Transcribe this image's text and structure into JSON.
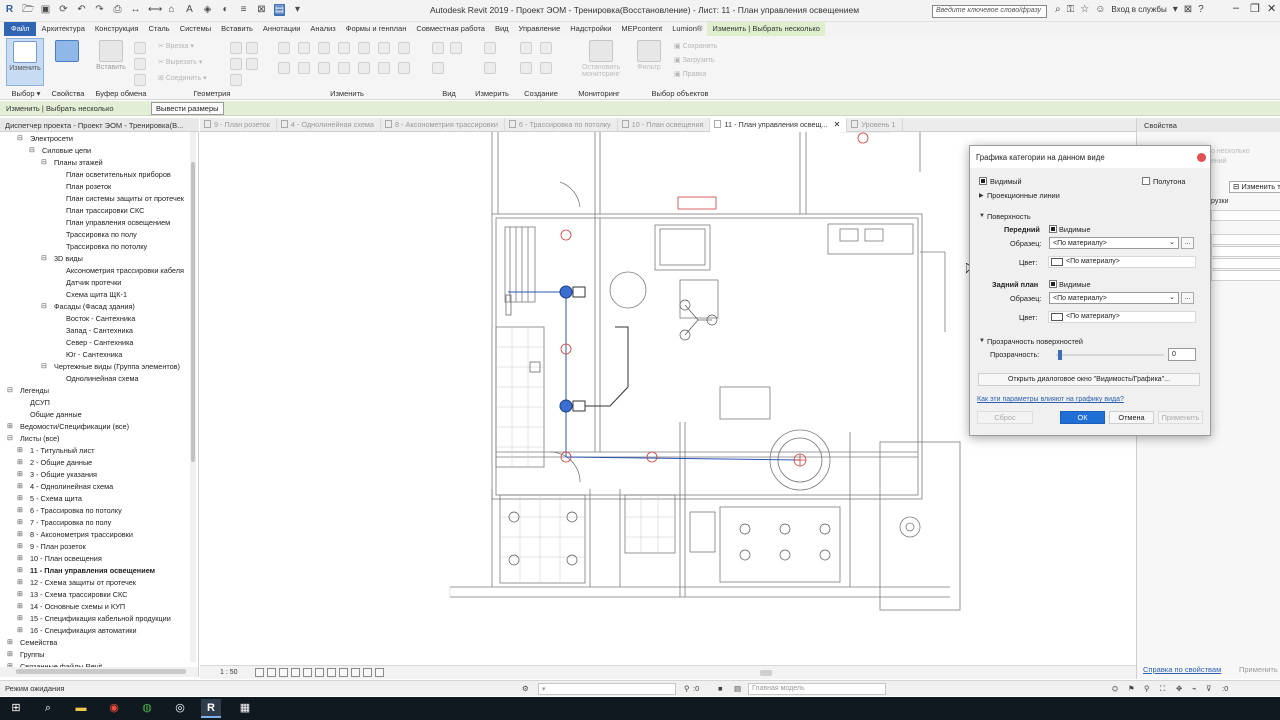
{
  "window": {
    "title": "Autodesk Revit 2019 - Проект ЭОМ - Тренировка(Восстановление) - Лист: 11 - План управления освещением",
    "search_placeholder": "Введите ключевое слово/фразу",
    "sign_in": "Вход в службы",
    "help": "?"
  },
  "ribbon_tabs": [
    "Файл",
    "Архитектура",
    "Конструкция",
    "Сталь",
    "Системы",
    "Вставить",
    "Аннотации",
    "Анализ",
    "Формы и генплан",
    "Совместная работа",
    "Вид",
    "Управление",
    "Надстройки",
    "MEPcontent",
    "Lumion®",
    "Изменить | Выбрать несколько"
  ],
  "ribbon": {
    "modify_label": "Изменить",
    "properties_label": "Свойства",
    "paste_label": "Вставить",
    "select_panel": "Выбор",
    "properties_panel": "Свойства",
    "clipboard_panel": "Буфер обмена",
    "geometry_panel": "Геометрия",
    "modify_panel": "Изменить",
    "view_panel": "Вид",
    "measure_panel": "Измерить",
    "create_panel": "Создание",
    "monitoring_panel": "Мониторинг",
    "select_objects_panel": "Выбор объектов",
    "cut_label": "Врезка",
    "cut2_label": "Вырезать",
    "join_label": "Соединить",
    "stop_monitor_label": "Остановить мониторинг",
    "filter_label": "Фильтр",
    "save_label": "Сохранить",
    "load_label": "Загрузить",
    "edit_label": "Правка"
  },
  "options_bar": {
    "breadcrumb": "Изменить | Выбрать несколько",
    "button": "Вывести размеры"
  },
  "project_browser": {
    "title": "Диспетчер проекта - Проект ЭОМ - Тренировка(В...",
    "items": [
      {
        "label": "Электросети",
        "toggle": "⊟"
      },
      {
        "label": "Силовые цепи",
        "toggle": "⊟"
      },
      {
        "label": "Планы этажей",
        "toggle": "⊟"
      },
      {
        "label": "План осветительных приборов",
        "toggle": ""
      },
      {
        "label": "План розеток",
        "toggle": ""
      },
      {
        "label": "План системы защиты от протечек",
        "toggle": ""
      },
      {
        "label": "План трассировки СКС",
        "toggle": ""
      },
      {
        "label": "План управления освещением",
        "toggle": ""
      },
      {
        "label": "Трассировка по полу",
        "toggle": ""
      },
      {
        "label": "Трассировка по потолку",
        "toggle": ""
      },
      {
        "label": "3D виды",
        "toggle": "⊟"
      },
      {
        "label": "Аксонометрия трассировки кабеля",
        "toggle": ""
      },
      {
        "label": "Датчик протечки",
        "toggle": ""
      },
      {
        "label": "Схема щита ЩК-1",
        "toggle": ""
      },
      {
        "label": "Фасады (Фасад здания)",
        "toggle": "⊟"
      },
      {
        "label": "Восток - Сантехника",
        "toggle": ""
      },
      {
        "label": "Запад - Сантехника",
        "toggle": ""
      },
      {
        "label": "Север - Сантехника",
        "toggle": ""
      },
      {
        "label": "Юг - Сантехника",
        "toggle": ""
      },
      {
        "label": "Чертежные виды (Группа элементов)",
        "toggle": "⊟"
      },
      {
        "label": "Однолинейная схема",
        "toggle": ""
      },
      {
        "label": "Легенды",
        "toggle": "⊟"
      },
      {
        "label": "ДСУП",
        "toggle": ""
      },
      {
        "label": "Общие данные",
        "toggle": ""
      },
      {
        "label": "Ведомости/Спецификации (все)",
        "toggle": "⊞"
      },
      {
        "label": "Листы (все)",
        "toggle": "⊟"
      },
      {
        "label": "1 - Титульный лист",
        "toggle": "⊞"
      },
      {
        "label": "2 - Общие данные",
        "toggle": "⊞"
      },
      {
        "label": "3 - Общие указания",
        "toggle": "⊞"
      },
      {
        "label": "4 - Однолинейная схема",
        "toggle": "⊞"
      },
      {
        "label": "5 - Схема щита",
        "toggle": "⊞"
      },
      {
        "label": "6 - Трассировка по потолку",
        "toggle": "⊞"
      },
      {
        "label": "7 - Трассировка по полу",
        "toggle": "⊞"
      },
      {
        "label": "8 - Аксонометрия трассировки",
        "toggle": "⊞"
      },
      {
        "label": "9 - План розеток",
        "toggle": "⊞"
      },
      {
        "label": "10 - План освещения",
        "toggle": "⊞"
      },
      {
        "label": "11 - План управления освещением",
        "toggle": "⊞"
      },
      {
        "label": "12 - Схема защиты от протечек",
        "toggle": "⊞"
      },
      {
        "label": "13 - Схема трассировки СКС",
        "toggle": "⊞"
      },
      {
        "label": "14 - Основные схемы и КУП",
        "toggle": "⊞"
      },
      {
        "label": "15 - Спецификация кабельной продукции",
        "toggle": "⊞"
      },
      {
        "label": "16 - Спецификация автоматики",
        "toggle": "⊞"
      },
      {
        "label": "Семейства",
        "toggle": "⊞"
      },
      {
        "label": "Группы",
        "toggle": "⊞"
      },
      {
        "label": "Связанные файлы Revit",
        "toggle": "⊞"
      }
    ]
  },
  "view_tabs": [
    {
      "label": "9 - План розеток",
      "active": false
    },
    {
      "label": "4 - Однолинейная схема",
      "active": false
    },
    {
      "label": "8 - Аксонометрия трассировки",
      "active": false
    },
    {
      "label": "6 - Трассировка по потолку",
      "active": false
    },
    {
      "label": "10 - План освещения",
      "active": false
    },
    {
      "label": "11 - План управления освещ...",
      "active": true
    },
    {
      "label": "Уровень 1",
      "active": false
    }
  ],
  "view_bar": {
    "scale": "1 : 50"
  },
  "properties": {
    "title": "Свойства",
    "edit_type": "Изменить тип",
    "faded1": "о несколько",
    "faded2": "ений",
    "faded3": "рузки",
    "help_link": "Справка по свойствам",
    "apply": "Применить"
  },
  "status_bar": {
    "text": "Режим ожидания",
    "counter": ":0",
    "model": "Главная модель",
    "filter_count": ":0"
  },
  "dialog": {
    "title": "Графика категории на данном виде",
    "visible_label": "Видимый",
    "halftone_label": "Полутона",
    "projection_lines": "Проекционные линии",
    "surface": "Поверхность",
    "foreground": "Передний",
    "background": "Задний план",
    "visible_check": "Видимые",
    "pattern_label": "Образец:",
    "pattern_value": "<По материалу>",
    "color_label": "Цвет:",
    "color_value": "<По материалу>",
    "transparency_section": "Прозрачность поверхностей",
    "transparency_label": "Прозрачность:",
    "transparency_value": "0",
    "open_vg_button": "Открыть диалоговое окно \"Видимость/Графика\"...",
    "help_link": "Как эти параметры влияют на графику вида?",
    "reset_button": "Сброс",
    "ok_button": "ОК",
    "cancel_button": "Отмена",
    "apply_button": "Применить"
  },
  "colors": {
    "accent": "#2f65b3",
    "context_tab": "#dfeecd",
    "device_red": "#d23a3a",
    "circuit_blue": "#2855b8"
  }
}
